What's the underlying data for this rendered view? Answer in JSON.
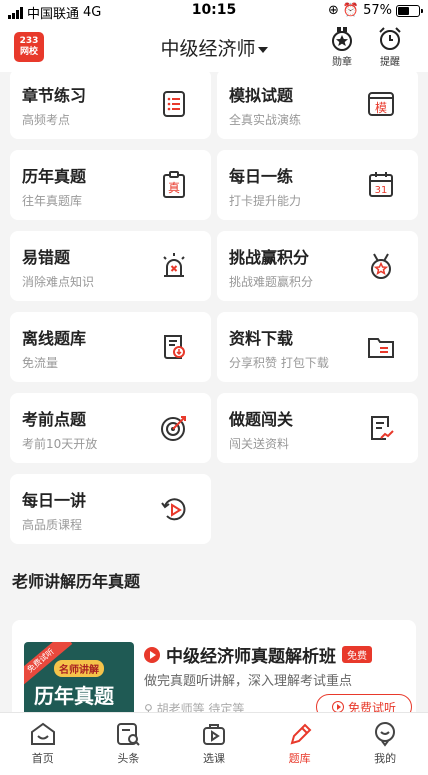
{
  "status": {
    "carrier": "中国联通",
    "network": "4G",
    "time": "10:15",
    "battery": "57%",
    "battery_level": 0.57
  },
  "nav": {
    "logo_top": "233",
    "logo_bottom": "网校",
    "title": "中级经济师",
    "medal_label": "勋章",
    "remind_label": "提醒"
  },
  "cards": [
    {
      "title": "章节练习",
      "sub": "高频考点",
      "icon": "list-doc-icon"
    },
    {
      "title": "模拟试题",
      "sub": "全真实战演练",
      "icon": "mock-exam-icon",
      "glyph": "模"
    },
    {
      "title": "历年真题",
      "sub": "往年真题库",
      "icon": "clipboard-icon",
      "glyph": "真"
    },
    {
      "title": "每日一练",
      "sub": "打卡提升能力",
      "icon": "calendar-icon",
      "glyph": "31"
    },
    {
      "title": "易错题",
      "sub": "消除难点知识",
      "icon": "alarm-icon"
    },
    {
      "title": "挑战赢积分",
      "sub": "挑战难题赢积分",
      "icon": "medal-icon"
    },
    {
      "title": "离线题库",
      "sub": "免流量",
      "icon": "download-doc-icon"
    },
    {
      "title": "资料下载",
      "sub": "分享积赞 打包下载",
      "icon": "folder-icon"
    },
    {
      "title": "考前点题",
      "sub": "考前10天开放",
      "icon": "target-icon"
    },
    {
      "title": "做题闯关",
      "sub": "闯关送资料",
      "icon": "chart-doc-icon"
    },
    {
      "title": "每日一讲",
      "sub": "高品质课程",
      "icon": "replay-icon"
    }
  ],
  "section": {
    "title": "老师讲解历年真题"
  },
  "course": {
    "ribbon": "免费试听",
    "tag": "名师讲解",
    "thumb_title": "历年真题",
    "name": "中级经济师真题解析班",
    "badge": "免费",
    "desc": "做完真题听讲解，深入理解考试重点",
    "meta": "胡老师等 待定等",
    "trial_label": "免费试听"
  },
  "tabs": [
    {
      "label": "首页",
      "icon": "home-icon"
    },
    {
      "label": "头条",
      "icon": "news-icon"
    },
    {
      "label": "选课",
      "icon": "course-bag-icon"
    },
    {
      "label": "题库",
      "icon": "pen-icon",
      "active": true
    },
    {
      "label": "我的",
      "icon": "profile-icon"
    }
  ],
  "colors": {
    "accent": "#e8392b",
    "background": "#f4f4f4"
  }
}
